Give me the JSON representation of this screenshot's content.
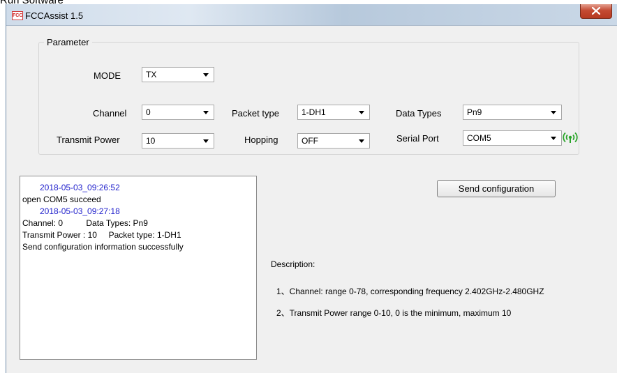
{
  "above_title": "Run Software",
  "window": {
    "title": "FCCAssist 1.5",
    "icon_text": "FCC"
  },
  "parameter": {
    "group_label": "Parameter",
    "mode": {
      "label": "MODE",
      "value": "TX"
    },
    "channel": {
      "label": "Channel",
      "value": "0"
    },
    "packet_type": {
      "label": "Packet type",
      "value": "1-DH1"
    },
    "data_types": {
      "label": "Data Types",
      "value": "Pn9"
    },
    "transmit_power": {
      "label": "Transmit Power",
      "value": "10"
    },
    "hopping": {
      "label": "Hopping",
      "value": "OFF"
    },
    "serial_port": {
      "label": "Serial Port",
      "value": "COM5"
    },
    "signal_icon": "wifi-signal-icon",
    "signal_color": "#2aa52a"
  },
  "log": {
    "lines": [
      "2018-05-03_09:26:52",
      "open COM5 succeed",
      "2018-05-03_09:27:18",
      "Channel: 0          Data Types: Pn9",
      "Transmit Power : 10     Packet type: 1-DH1",
      "Send configuration information successfully"
    ],
    "timestamp_color": "#2222cc"
  },
  "send_button": "Send configuration",
  "description": {
    "title": "Description:",
    "items": [
      "1、Channel: range 0-78, corresponding frequency 2.402GHz-2.480GHZ",
      "2、Transmit Power  range 0-10, 0 is the minimum, maximum 10"
    ]
  }
}
